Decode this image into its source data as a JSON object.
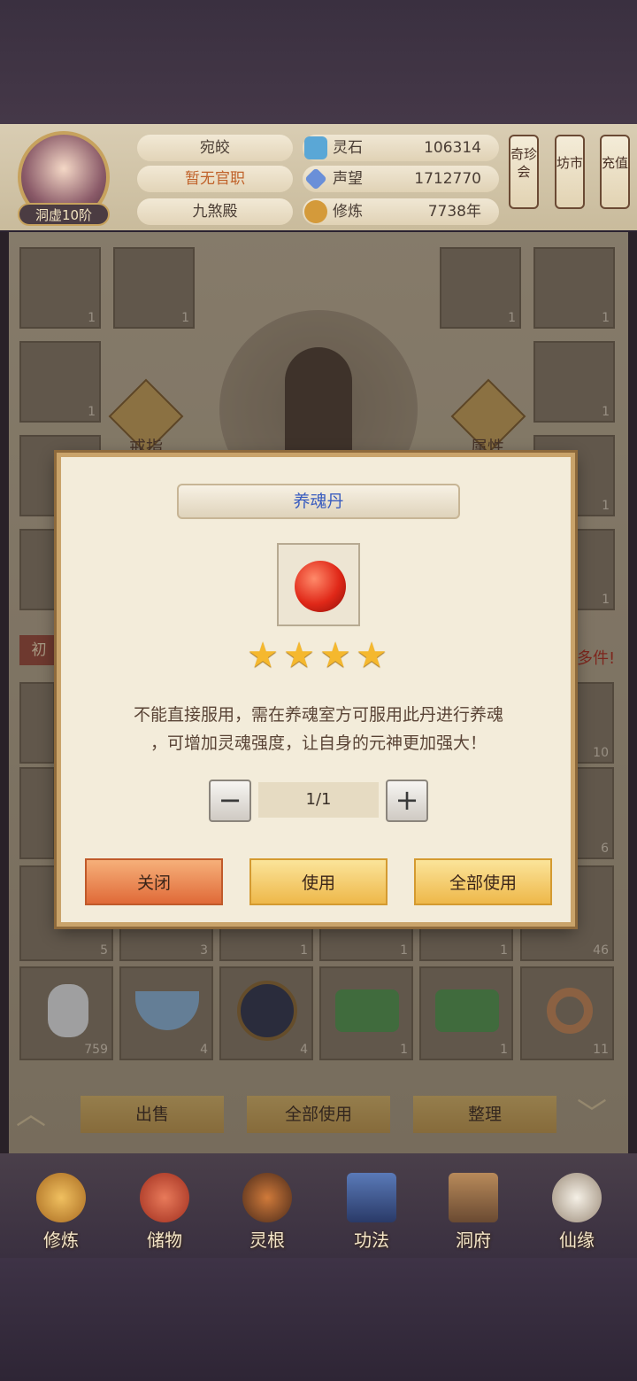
{
  "header": {
    "name": "宛皎",
    "official_title": "暂无官职",
    "sect": "九煞殿",
    "rank": "洞虚10阶",
    "stats": [
      {
        "label": "灵石",
        "value": "106314",
        "icon": "spirit-stone-icon",
        "color": "#5aa7d6"
      },
      {
        "label": "声望",
        "value": "1712770",
        "icon": "prestige-crystal-icon",
        "color": "#6a8fd8"
      },
      {
        "label": "修炼",
        "value": "7738年",
        "icon": "meditation-icon",
        "color": "#d49a3a"
      }
    ],
    "side_buttons": [
      "奇珍会",
      "坊市",
      "充值"
    ]
  },
  "inventory": {
    "left_top_counts": [
      "1",
      "1"
    ],
    "right_top_counts": [
      "1",
      "1"
    ],
    "row2_left_count": "1",
    "row2_right_count": "1",
    "right_col_counts": [
      "1",
      "1"
    ],
    "left_labels": [
      "戒指",
      "属性"
    ],
    "tab_partial": "初",
    "notice_partial": "多件!",
    "grid_counts_row1": [
      "10"
    ],
    "grid_counts_row2": [
      "6"
    ],
    "grid_counts_row3": [
      "5",
      "3",
      "1",
      "1",
      "1",
      "46"
    ],
    "grid_counts_row4": [
      "759",
      "4",
      "4",
      "1",
      "1",
      "11"
    ]
  },
  "actions": {
    "sell": "出售",
    "use_all": "全部使用",
    "sort": "整理"
  },
  "nav": [
    {
      "label": "修炼",
      "icon": "cultivation-icon"
    },
    {
      "label": "储物",
      "icon": "storage-bag-icon"
    },
    {
      "label": "灵根",
      "icon": "spirit-root-icon"
    },
    {
      "label": "功法",
      "icon": "technique-book-icon"
    },
    {
      "label": "洞府",
      "icon": "cave-dwelling-icon"
    },
    {
      "label": "仙缘",
      "icon": "immortal-fate-icon"
    }
  ],
  "dialog": {
    "title": "养魂丹",
    "item_icon": "red-pill-icon",
    "stars": 4,
    "description_line1": "不能直接服用，需在养魂室方可服用此丹进行养魂",
    "description_line2": "，可增加灵魂强度，让自身的元神更加强大！",
    "quantity": "1/1",
    "minus": "−",
    "plus": "+",
    "close_label": "关闭",
    "use_label": "使用",
    "use_all_label": "全部使用"
  }
}
